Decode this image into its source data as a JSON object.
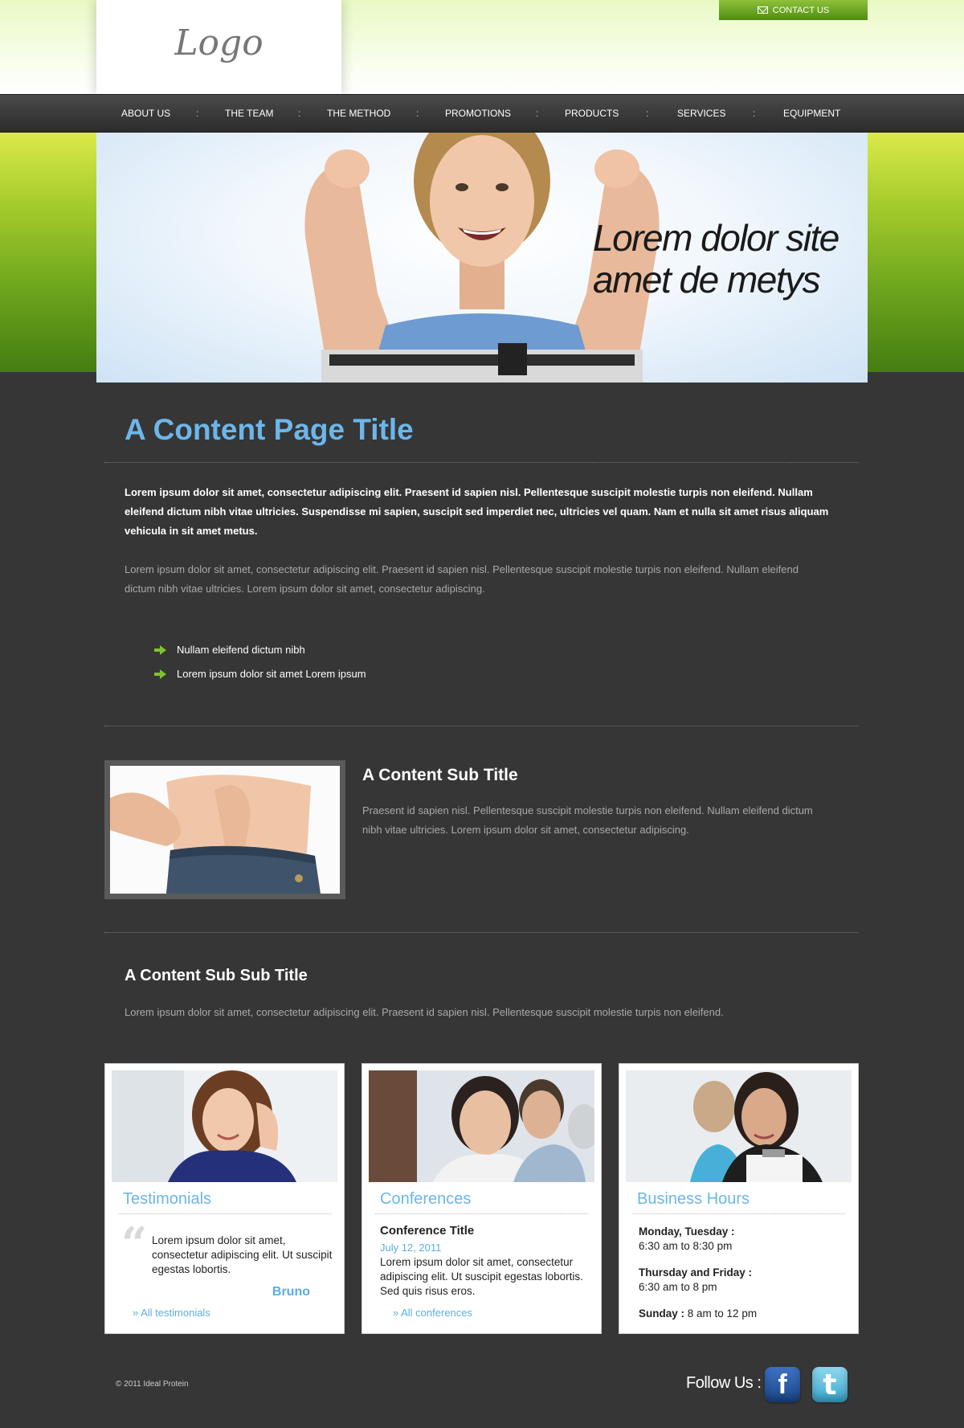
{
  "header": {
    "logo": "Logo",
    "contact_label": "CONTACT US"
  },
  "nav": {
    "items": [
      "ABOUT US",
      "THE TEAM",
      "THE METHOD",
      "PROMOTIONS",
      "PRODUCTS",
      "SERVICES",
      "EQUIPMENT"
    ],
    "separator": ":"
  },
  "hero": {
    "line1": "Lorem dolor site",
    "line2": "amet de metys"
  },
  "content": {
    "title": "A Content Page Title",
    "intro": "Lorem ipsum dolor sit amet, consectetur adipiscing elit. Praesent id sapien nisl. Pellentesque suscipit molestie turpis non eleifend. Nullam eleifend dictum nibh vitae ultricies. Suspendisse mi sapien, suscipit sed imperdiet nec, ultricies vel quam. Nam et nulla sit amet risus aliquam vehicula in sit amet metus.",
    "paragraph": "Lorem ipsum dolor sit amet, consectetur adipiscing elit. Praesent id sapien nisl. Pellentesque suscipit molestie turpis non eleifend. Nullam eleifend dictum nibh vitae ultricies. Lorem ipsum dolor sit amet, consectetur adipiscing.",
    "bullets": [
      "Nullam eleifend dictum nibh",
      "Lorem ipsum dolor sit amet Lorem ipsum"
    ],
    "sub_title": "A Content Sub Title",
    "sub_text": "Praesent id sapien nisl. Pellentesque suscipit molestie turpis non eleifend. Nullam eleifend dictum nibh vitae ultricies. Lorem ipsum dolor sit amet, consectetur adipiscing.",
    "subsub_title": "A Content Sub Sub Title",
    "subsub_text": "Lorem ipsum dolor sit amet, consectetur adipiscing elit. Praesent id sapien nisl. Pellentesque suscipit molestie turpis non eleifend."
  },
  "cards": {
    "testimonials": {
      "title": "Testimonials",
      "quote": "Lorem ipsum dolor sit amet, consectetur adipiscing elit. Ut suscipit egestas lobortis.",
      "author": "Bruno",
      "link": "» All testimonials"
    },
    "conferences": {
      "title": "Conferences",
      "conf_title": "Conference Title",
      "date": "July 12, 2011",
      "text": "Lorem ipsum dolor sit amet, consectetur adipiscing elit. Ut suscipit egestas lobortis. Sed quis risus eros.",
      "link": "» All conferences"
    },
    "hours": {
      "title": "Business Hours",
      "day1": "Monday, Tuesday :",
      "time1": "6:30 am to 8:30 pm",
      "day2": "Thursday and Friday :",
      "time2": "6:30 am to 8 pm",
      "day3": "Sunday :",
      "time3": "8 am to 12 pm"
    }
  },
  "footer": {
    "copyright": "© 2011 Ideal Protein",
    "follow": "Follow Us :",
    "facebook_glyph": "f",
    "twitter_glyph": "t"
  },
  "colors": {
    "accent_blue": "#6cb6ea",
    "green": "#7ec32c",
    "background": "#363636"
  },
  "icons": [
    "mail-icon",
    "arrow-right-icon",
    "quote-icon",
    "facebook-icon",
    "twitter-icon"
  ]
}
